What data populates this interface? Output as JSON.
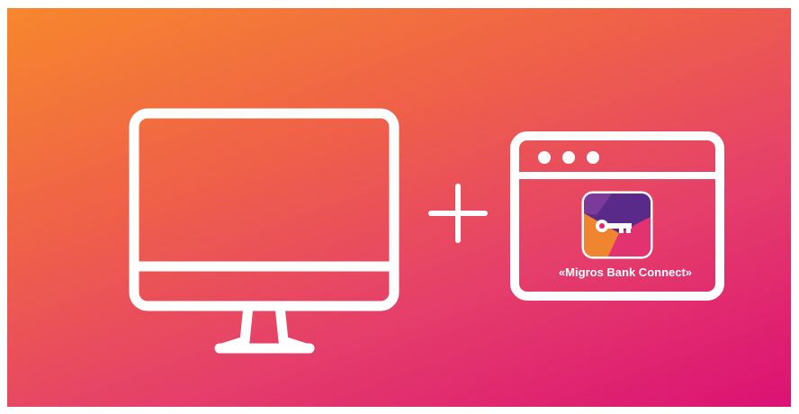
{
  "banner": {
    "app_label": "«Migros Bank Connect»"
  },
  "icons": {
    "computer": "desktop-monitor-icon",
    "plus": "plus-icon",
    "browser": "browser-window-icon",
    "app": "key-app-icon"
  },
  "colors": {
    "gradient_start": "#f7872d",
    "gradient_end": "#dc1174",
    "stroke": "#ffffff",
    "app_purple": "#5a2a8a",
    "app_orange": "#f08530",
    "app_pink": "#e3256e"
  }
}
